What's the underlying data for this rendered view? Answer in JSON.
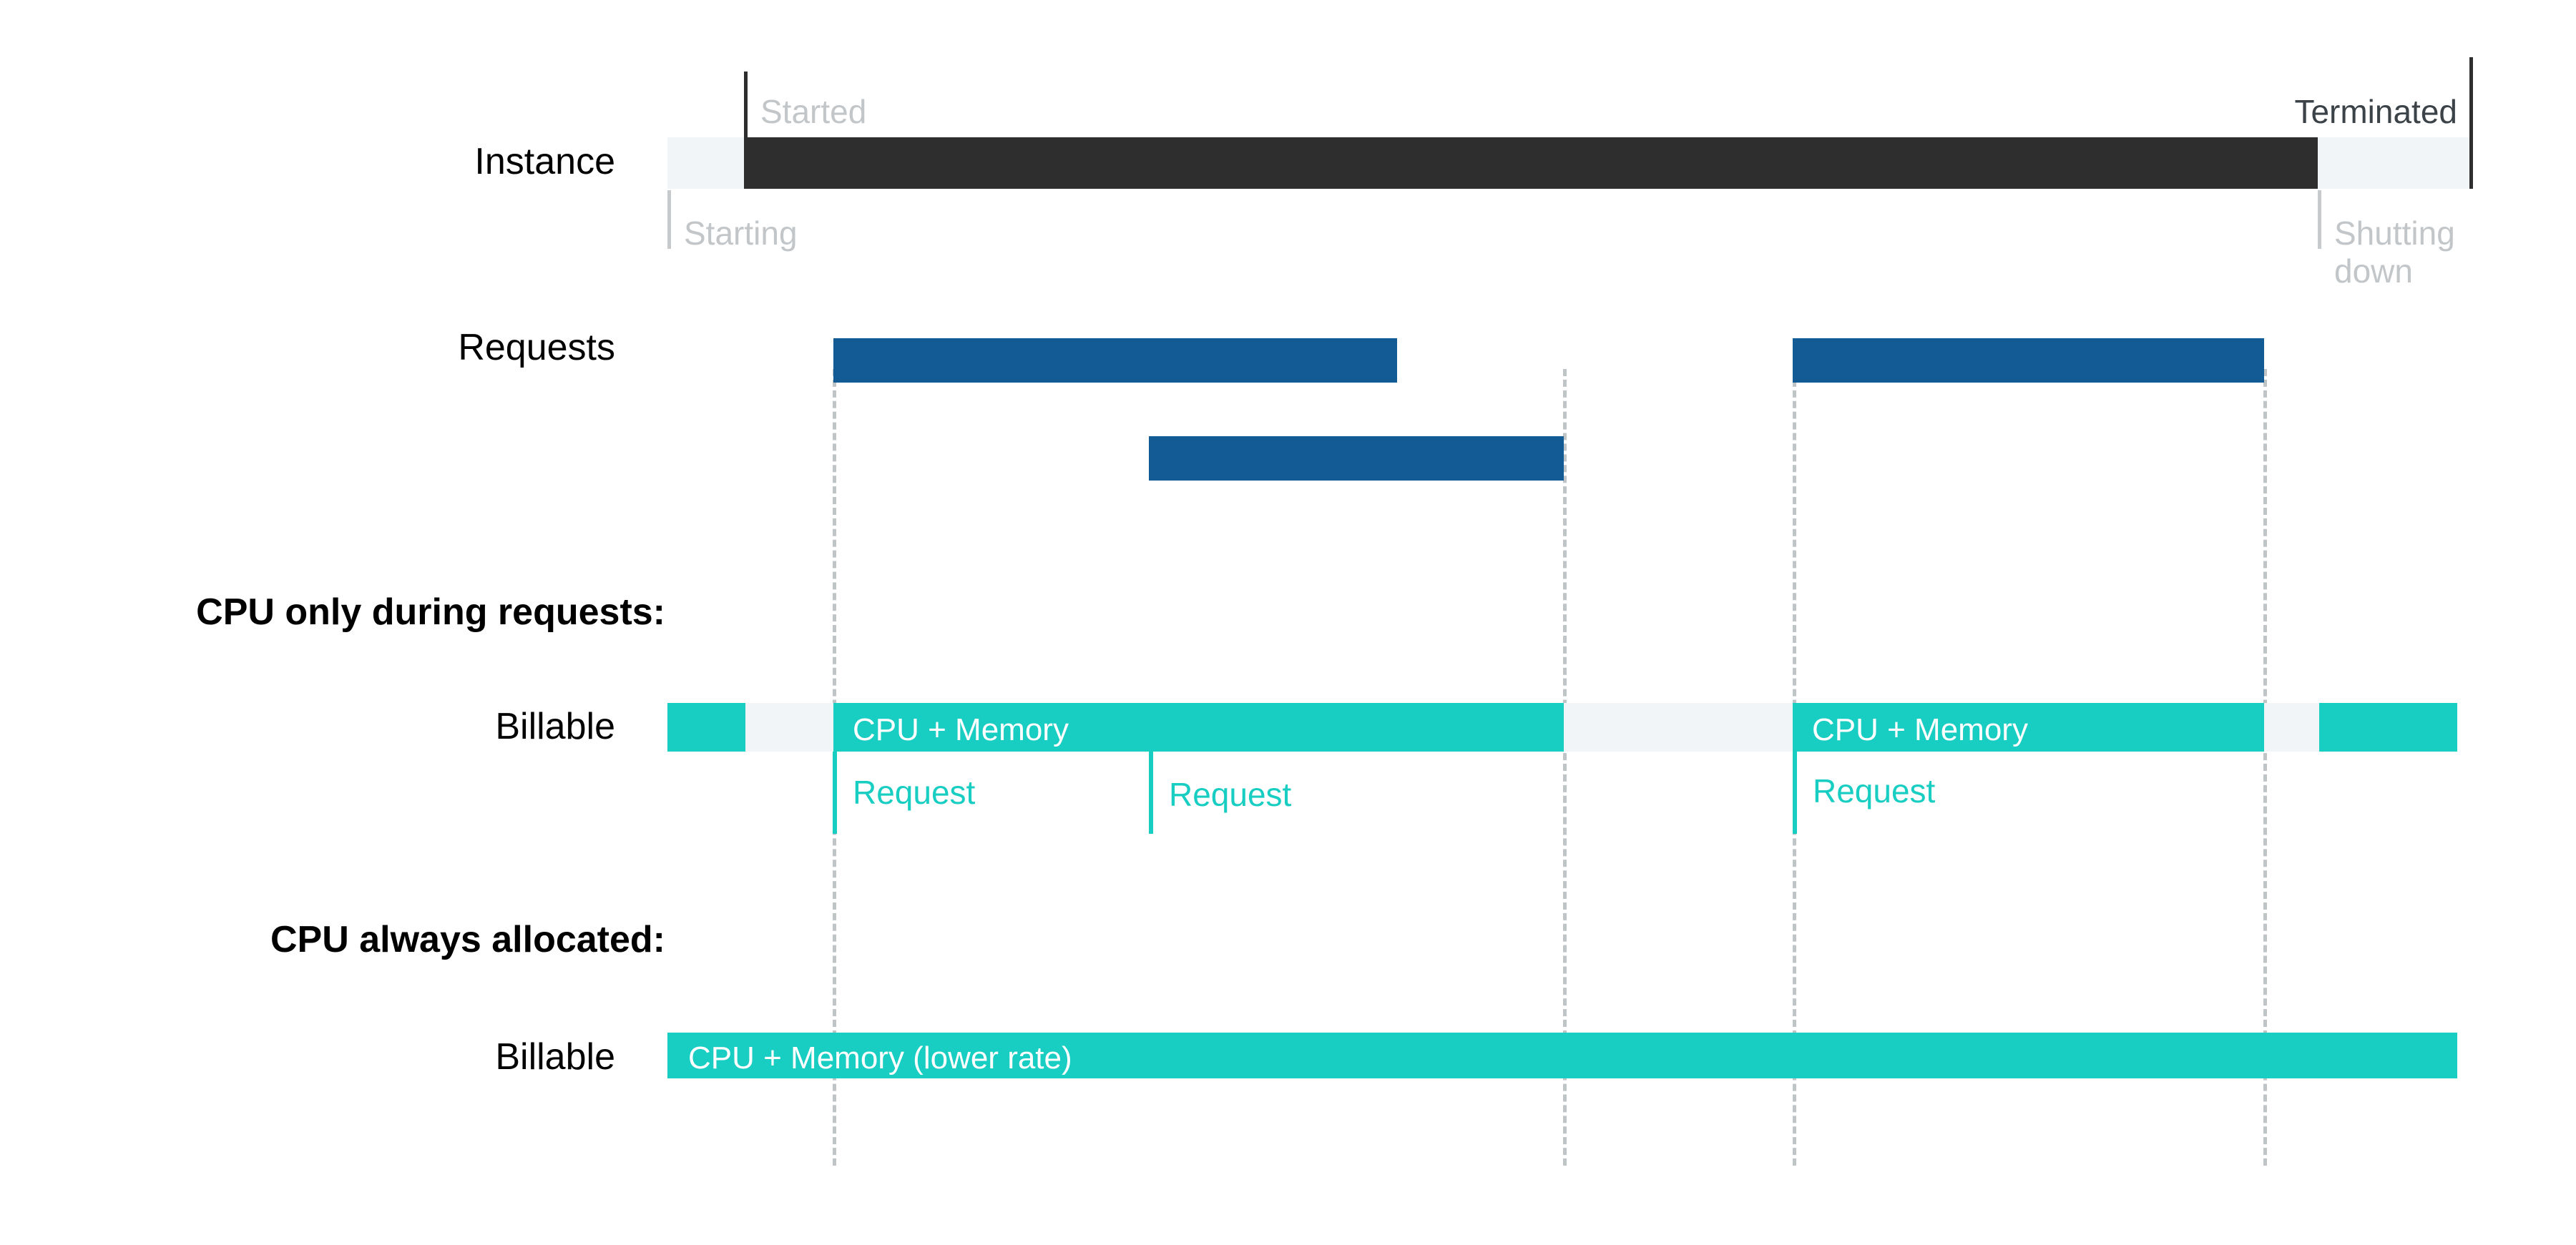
{
  "diagram": {
    "title_hidden": "",
    "colors": {
      "instance_running": "#2e2e2e",
      "instance_transition": "#f2f5f7",
      "request": "#135b94",
      "billable": "#18cdc2",
      "billable_idle": "#f2f5f7",
      "muted_text": "#c2c6c9",
      "dark_text": "#3b4348",
      "dashed_guide": "#bfc4c7",
      "background": "#ffffff"
    }
  },
  "rows": {
    "instance": {
      "label": "Instance",
      "states": {
        "starting": "Starting",
        "started": "Started",
        "terminated": "Terminated",
        "shutting_down": "Shutting down"
      }
    },
    "requests": {
      "label": "Requests"
    },
    "billable_per_request": {
      "label": "Billable",
      "segments": [
        {
          "label": ""
        },
        {
          "label": "CPU + Memory"
        },
        {
          "label": "CPU + Memory"
        },
        {
          "label": ""
        }
      ],
      "request_markers": [
        {
          "label": "Request"
        },
        {
          "label": "Request"
        },
        {
          "label": "Request"
        }
      ]
    },
    "billable_always_on": {
      "label": "Billable",
      "segments": [
        {
          "label": "CPU + Memory (lower rate)"
        }
      ]
    }
  },
  "sections": {
    "cpu_during_requests": "CPU only during requests:",
    "cpu_always_allocated": "CPU always allocated:"
  },
  "chart_data": {
    "type": "timeline",
    "x_range": [
      0,
      3601
    ],
    "title": "",
    "xlabel": "",
    "ylabel": "",
    "lanes": [
      {
        "name": "Instance",
        "y": 192,
        "height": 72,
        "bars": [
          {
            "name": "starting",
            "x0": 933,
            "x1": 1040,
            "color": "#f2f5f7"
          },
          {
            "name": "running",
            "x0": 1040,
            "x1": 3240,
            "color": "#2e2e2e"
          },
          {
            "name": "shutting-down",
            "x0": 3240,
            "x1": 3455,
            "color": "#f2f5f7"
          }
        ],
        "markers": [
          {
            "name": "Started",
            "x": 1040,
            "align": "left"
          },
          {
            "name": "Terminated",
            "x": 3455,
            "align": "right"
          },
          {
            "name": "Starting",
            "x": 933,
            "align": "left"
          },
          {
            "name": "Shutting down",
            "x": 3240,
            "align": "left"
          }
        ]
      },
      {
        "name": "Requests",
        "y": 473,
        "height": 62,
        "bars": [
          {
            "name": "request-1",
            "x0": 1165,
            "x1": 1953,
            "row": 0,
            "color": "#135b94"
          },
          {
            "name": "request-2",
            "x0": 1606,
            "x1": 2186,
            "row": 1,
            "color": "#135b94"
          },
          {
            "name": "request-3",
            "x0": 2506,
            "x1": 3165,
            "row": 0,
            "color": "#135b94"
          }
        ]
      },
      {
        "name": "Billable (CPU only during requests)",
        "y": 983,
        "height": 68,
        "bars": [
          {
            "name": "billable-startup",
            "x0": 933,
            "x1": 1042,
            "color": "#18cdc2"
          },
          {
            "name": "idle-1",
            "x0": 1042,
            "x1": 1165,
            "color": "#f2f5f7"
          },
          {
            "name": "billable-burst-1",
            "x0": 1165,
            "x1": 2186,
            "color": "#18cdc2"
          },
          {
            "name": "idle-2",
            "x0": 2186,
            "x1": 2506,
            "color": "#f2f5f7"
          },
          {
            "name": "billable-burst-2",
            "x0": 2506,
            "x1": 3165,
            "color": "#18cdc2"
          },
          {
            "name": "idle-3",
            "x0": 3165,
            "x1": 3242,
            "color": "#f2f5f7"
          },
          {
            "name": "billable-shutdown",
            "x0": 3242,
            "x1": 3435,
            "color": "#18cdc2"
          }
        ]
      },
      {
        "name": "Billable (CPU always allocated)",
        "y": 1444,
        "height": 64,
        "bars": [
          {
            "name": "billable-full",
            "x0": 933,
            "x1": 3435,
            "color": "#18cdc2"
          }
        ]
      }
    ],
    "guides": [
      {
        "x": 1164,
        "y0": 516,
        "y1": 1630
      },
      {
        "x": 2185,
        "y0": 516,
        "y1": 1630
      },
      {
        "x": 2506,
        "y0": 516,
        "y1": 1630
      },
      {
        "x": 3164,
        "y0": 516,
        "y1": 1630
      }
    ]
  }
}
